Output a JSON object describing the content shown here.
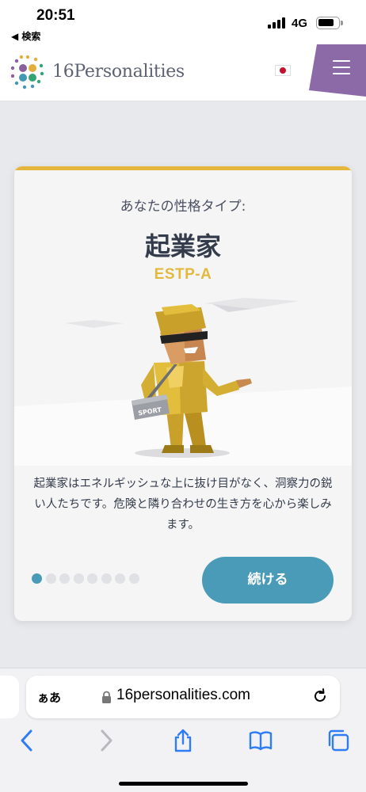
{
  "status_bar": {
    "time": "20:51",
    "back_label": "◀ 検索",
    "network": "4G"
  },
  "header": {
    "logo_text": "16Personalities",
    "language_flag": "japan-flag-icon",
    "menu_icon": "hamburger-menu-icon",
    "accent_color": "#8c6aa8"
  },
  "result_card": {
    "label": "あなたの性格タイプ:",
    "type_name": "起業家",
    "type_code": "ESTP-A",
    "description": "起業家はエネルギッシュな上に抜け目がなく、洞察力の鋭い人たちです。危険と隣り合わせの生き方を心から楽しみます。",
    "bag_text": "SPORT",
    "dots": {
      "total": 8,
      "active_index": 0
    },
    "continue_label": "続ける",
    "accent_color": "#e5b63b",
    "button_color": "#4a9bb8"
  },
  "browser": {
    "text_size_label": "ぁあ",
    "url": "16personalities.com",
    "toolbar": [
      "back-icon",
      "forward-icon",
      "share-icon",
      "bookmarks-icon",
      "tabs-icon"
    ]
  }
}
